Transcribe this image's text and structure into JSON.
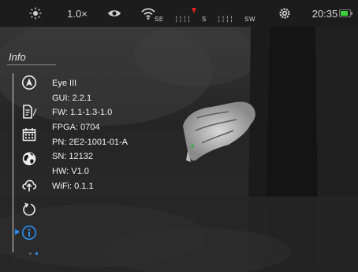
{
  "status_bar": {
    "brightness_icon": "sun-icon",
    "zoom": "1.0×",
    "mode_icon": "eye-icon",
    "wifi_icon": "wifi-icon",
    "compass": {
      "labels": [
        "SE",
        "S",
        "SW"
      ],
      "marker_color": "#d9231e"
    },
    "settings_icon": "gear-icon",
    "time": "20:35",
    "battery": {
      "level": 0.85,
      "color": "#3bd13b"
    }
  },
  "info_panel": {
    "title": "Info",
    "lines": [
      "Eye III",
      "GUI: 2.2.1",
      "FW: 1.1-1.3-1.0",
      "FPGA: 0704",
      "PN: 2E2-1001-01-A",
      "SN: 12132",
      "HW: V1.0",
      "WiFi: 0.1.1"
    ]
  },
  "menu": {
    "items": [
      {
        "icon": "compass-icon",
        "selected": false
      },
      {
        "icon": "calibration-icon",
        "selected": false
      },
      {
        "icon": "calendar-icon",
        "selected": false
      },
      {
        "icon": "globe-icon",
        "selected": false
      },
      {
        "icon": "cloud-upload-icon",
        "selected": false
      },
      {
        "icon": "reset-icon",
        "selected": false
      },
      {
        "icon": "info-icon",
        "selected": true
      }
    ],
    "accent_color": "#2a8ef0",
    "page_indicator": {
      "pages": 2,
      "current": 2
    }
  }
}
